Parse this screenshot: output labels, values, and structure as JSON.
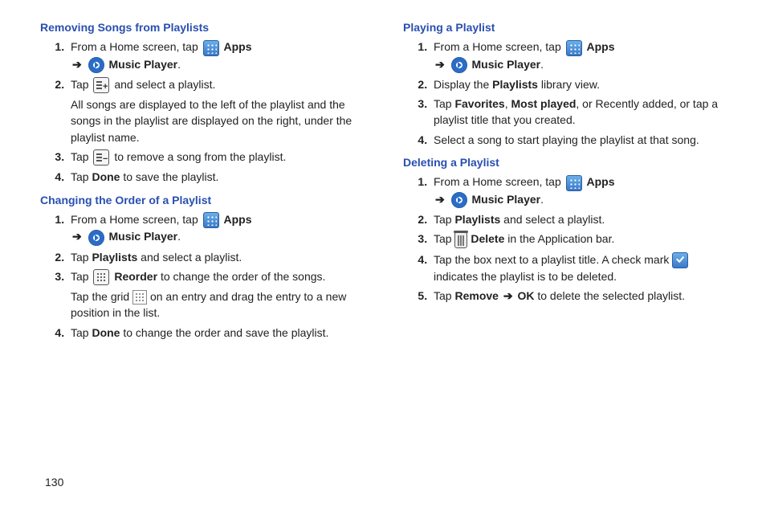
{
  "pageNumber": "130",
  "left": {
    "h1": "Removing Songs from Playlists",
    "s1": {
      "n1a": "From a Home screen, tap ",
      "apps": "Apps",
      "arrow": "➔",
      "music": "Music Player",
      "n2a": "Tap ",
      "n2b": " and select a playlist.",
      "n2c": "All songs are displayed to the left of the playlist and the songs in the playlist are displayed on the right, under the playlist name.",
      "n3a": "Tap ",
      "n3b": " to remove a song from the playlist.",
      "n4a": "Tap ",
      "done": "Done",
      "n4b": " to save the playlist."
    },
    "h2": "Changing the Order of a Playlist",
    "s2": {
      "n1a": "From a Home screen, tap ",
      "n2a": "Tap ",
      "playlists": "Playlists",
      "n2b": " and select a playlist.",
      "n3a": "Tap ",
      "reorder": "Reorder",
      "n3b": " to change the order of the songs.",
      "n3c": "Tap the grid ",
      "n3d": " on an entry and drag the entry to a new position in the list.",
      "n4a": "Tap ",
      "done": "Done",
      "n4b": " to change the order and save the playlist."
    }
  },
  "right": {
    "h1": "Playing a Playlist",
    "s1": {
      "n1a": "From a Home screen, tap ",
      "apps": "Apps",
      "arrow": "➔",
      "music": "Music Player",
      "n2a": "Display the ",
      "playlists": "Playlists",
      "n2b": " library view.",
      "n3a": "Tap ",
      "fav": "Favorites",
      "comma": ", ",
      "most": "Most played",
      "n3b": ", or Recently added, or tap a playlist title that you created.",
      "n4": "Select a song to start playing the playlist at that song."
    },
    "h2": "Deleting a Playlist",
    "s2": {
      "n1a": "From a Home screen, tap ",
      "n2a": "Tap ",
      "playlists": "Playlists",
      "n2b": " and select a playlist.",
      "n3a": "Tap ",
      "delete": "Delete",
      "n3b": " in the Application bar.",
      "n4a": "Tap the box next to a playlist title. A check mark ",
      "n4b": " indicates the playlist is to be deleted.",
      "n5a": "Tap ",
      "remove": "Remove",
      "arrow": "➔",
      "ok": "OK",
      "n5b": " to delete the selected playlist."
    }
  }
}
